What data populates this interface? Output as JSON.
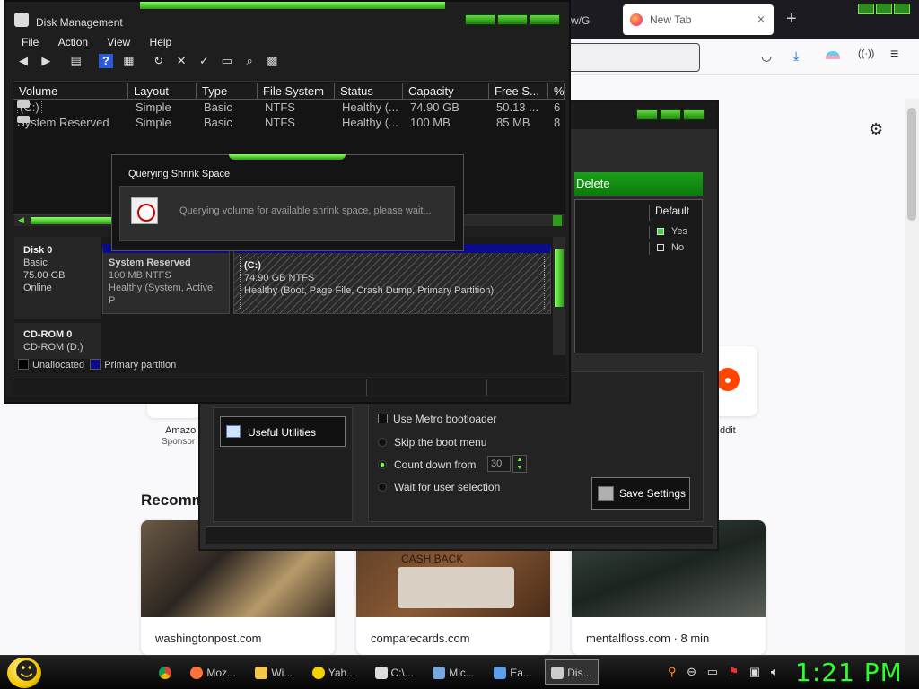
{
  "firefox": {
    "partial_tab": "w/G",
    "active_tab": "New Tab",
    "close_glyph": "×",
    "plus_glyph": "+",
    "gear_glyph": "⚙",
    "amazon_label": "Amazo",
    "amazon_sponsored": "Sponsor",
    "reddit_label": "ddit",
    "recommended": "Recomm",
    "cards": [
      {
        "label": "washingtonpost.com"
      },
      {
        "label": "comparecards.com",
        "image_text": "CASH BACK"
      },
      {
        "label": "mentalfloss.com · 8 min"
      }
    ]
  },
  "boot_window": {
    "delete_label": "Delete",
    "column_default": "Default",
    "rows": [
      {
        "label": "Yes"
      },
      {
        "label": "No"
      }
    ],
    "useful_utilities": "Useful Utilities",
    "options": {
      "metro": "Use Metro bootloader",
      "skip": "Skip the boot menu",
      "count": "Count down from",
      "wait": "Wait for user selection"
    },
    "countdown_value": "30",
    "save_settings": "Save Settings"
  },
  "disk_mgmt": {
    "title": "Disk Management",
    "menu": [
      "File",
      "Action",
      "View",
      "Help"
    ],
    "columns": [
      "Volume",
      "Layout",
      "Type",
      "File System",
      "Status",
      "Capacity",
      "Free S...",
      "%"
    ],
    "volumes": [
      {
        "volume": "(C:)",
        "layout": "Simple",
        "type": "Basic",
        "fs": "NTFS",
        "status": "Healthy (...",
        "capacity": "74.90 GB",
        "free": "50.13 ...",
        "pct": "6"
      },
      {
        "volume": "System Reserved",
        "layout": "Simple",
        "type": "Basic",
        "fs": "NTFS",
        "status": "Healthy (...",
        "capacity": "100 MB",
        "free": "85 MB",
        "pct": "8"
      }
    ],
    "disk0": {
      "name": "Disk 0",
      "type": "Basic",
      "size": "75.00 GB",
      "state": "Online"
    },
    "cdrom0": {
      "name": "CD-ROM 0",
      "drive": "CD-ROM (D:)"
    },
    "partitions": {
      "sysres": {
        "name": "System Reserved",
        "size": "100 MB NTFS",
        "status": "Healthy (System, Active, P"
      },
      "c": {
        "name": "(C:)",
        "size": "74.90 GB NTFS",
        "status": "Healthy (Boot, Page File, Crash Dump, Primary Partition)"
      }
    },
    "legend": {
      "unallocated": "Unallocated",
      "primary": "Primary partition"
    },
    "colors": {
      "primary": "#0a0a8a",
      "unallocated": "#000000",
      "accent": "#5fdc3a"
    }
  },
  "dialog": {
    "title": "Querying Shrink Space",
    "message": "Querying volume for available shrink space, please wait..."
  },
  "taskbar": {
    "apps": [
      {
        "label": "Moz..."
      },
      {
        "label": "Wi..."
      },
      {
        "label": "Yah..."
      },
      {
        "label": "C:\\..."
      },
      {
        "label": "Mic..."
      },
      {
        "label": "Ea..."
      },
      {
        "label": "Dis..."
      }
    ],
    "clock": "1:21 PM"
  }
}
